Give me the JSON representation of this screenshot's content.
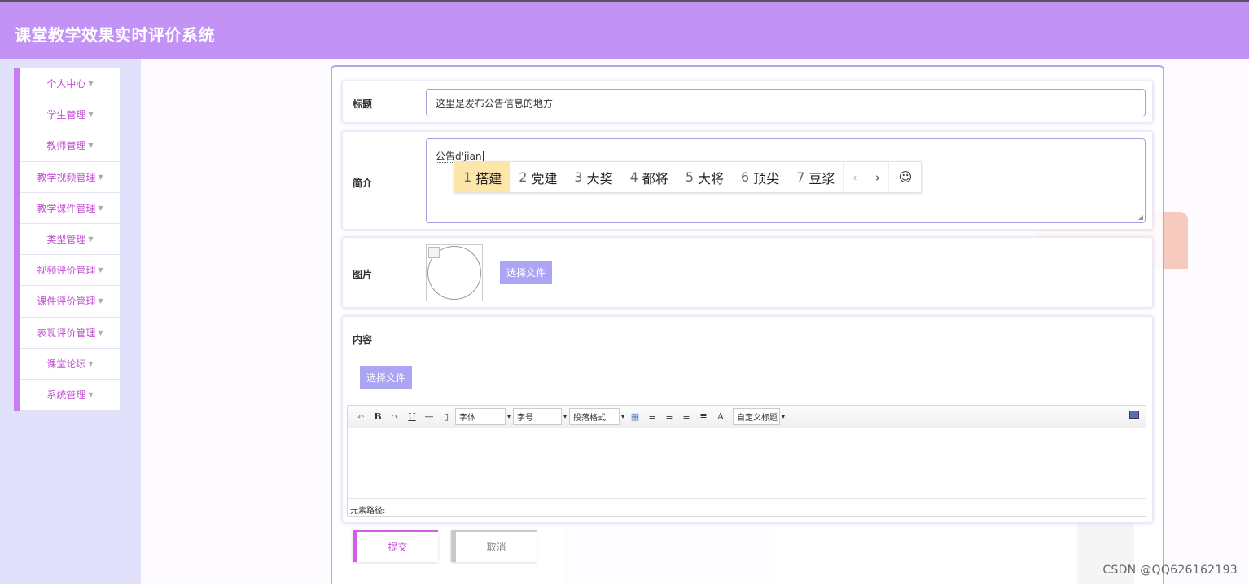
{
  "header": {
    "title": "课堂教学效果实时评价系统"
  },
  "sidebar": {
    "items": [
      {
        "label": "个人中心"
      },
      {
        "label": "学生管理"
      },
      {
        "label": "教师管理"
      },
      {
        "label": "教学视频管理"
      },
      {
        "label": "教学课件管理"
      },
      {
        "label": "类型管理"
      },
      {
        "label": "视频评价管理"
      },
      {
        "label": "课件评价管理"
      },
      {
        "label": "表现评价管理"
      },
      {
        "label": "课堂论坛"
      },
      {
        "label": "系统管理"
      }
    ]
  },
  "form": {
    "title_label": "标题",
    "title_value": "这里是发布公告信息的地方",
    "intro_label": "简介",
    "intro_value": "公告d'jian",
    "image_label": "图片",
    "image_button": "选择文件",
    "content_label": "内容",
    "content_button": "选择文件",
    "submit_label": "提交",
    "cancel_label": "取消"
  },
  "ime": {
    "candidates": [
      {
        "num": "1",
        "text": "搭建"
      },
      {
        "num": "2",
        "text": "党建"
      },
      {
        "num": "3",
        "text": "大奖"
      },
      {
        "num": "4",
        "text": "都将"
      },
      {
        "num": "5",
        "text": "大将"
      },
      {
        "num": "6",
        "text": "顶尖"
      },
      {
        "num": "7",
        "text": "豆浆"
      }
    ],
    "prev": "‹",
    "next": "›",
    "emoji": "☺"
  },
  "editor": {
    "font_select": "字体",
    "size_select": "字号",
    "paragraph_select": "段落格式",
    "custom_title_select": "自定义标题",
    "font_color_glyph": "A",
    "status_label": "元素路径:"
  },
  "watermark": "CSDN @QQ626162193"
}
